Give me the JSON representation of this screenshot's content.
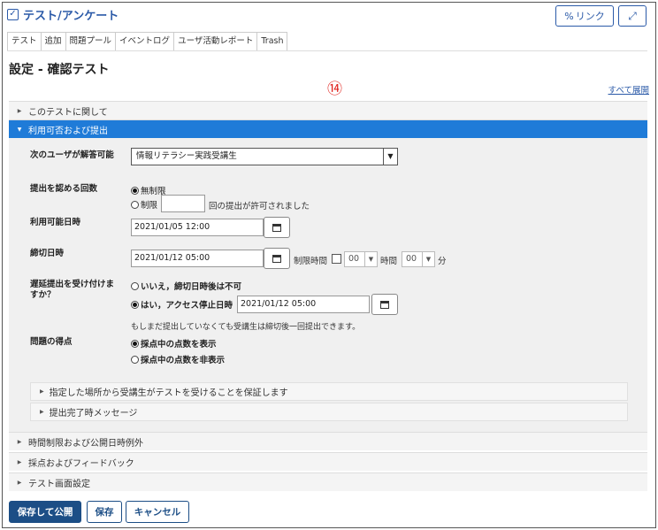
{
  "header": {
    "title": "テスト/アンケート",
    "link_label": "リンク"
  },
  "tabs": [
    "テスト",
    "追加",
    "問題プール",
    "イベントログ",
    "ユーザ活動レポート",
    "Trash"
  ],
  "page": {
    "title": "設定 - 確認テスト",
    "annotation": "⑭",
    "expand_all": "すべて展開"
  },
  "sections": {
    "about": "このテストに関して",
    "availability": "利用可否および提出",
    "timing": "時間制限および公開日時例外",
    "grading": "採点およびフィードバック",
    "display": "テスト画面設定"
  },
  "form": {
    "who_label": "次のユーザが解答可能",
    "who_value": "情報リテラシー実践受講生",
    "attempts_label": "提出を認める回数",
    "attempts_unlimited": "無制限",
    "attempts_limited": "制限",
    "attempts_suffix": "回の提出が許可されました",
    "attempts_value": "",
    "available_label": "利用可能日時",
    "available_value": "2021/01/05 12:00",
    "due_label": "締切日時",
    "due_value": "2021/01/12 05:00",
    "time_limit_label": "制限時間",
    "hours_value": "00",
    "hours_label": "時間",
    "minutes_value": "00",
    "minutes_label": "分",
    "late_label": "遅延提出を受け付けますか？",
    "late_no": "いいえ，締切日時後は不可",
    "late_yes": "はい，アクセス停止日時",
    "late_date": "2021/01/12 05:00",
    "late_note": "もしまだ提出していなくても受講生は締切後一回提出できます。",
    "points_label": "問題の得点",
    "points_show": "採点中の点数を表示",
    "points_hide": "採点中の点数を非表示"
  },
  "subsections": {
    "location": "指定した場所から受講生がテストを受けることを保証します",
    "completion": "提出完了時メッセージ"
  },
  "buttons": {
    "save_publish": "保存して公開",
    "save": "保存",
    "cancel": "キャンセル"
  },
  "colors": {
    "accent": "#1f7bd8",
    "primary_button": "#1c4e86",
    "link": "#2b5aa8",
    "annotation": "#e0201b"
  },
  "icons": {
    "check": "check-icon",
    "link": "link-icon",
    "expand": "expand-icon",
    "calendar": "calendar-icon",
    "chevron": "chevron-icon"
  }
}
